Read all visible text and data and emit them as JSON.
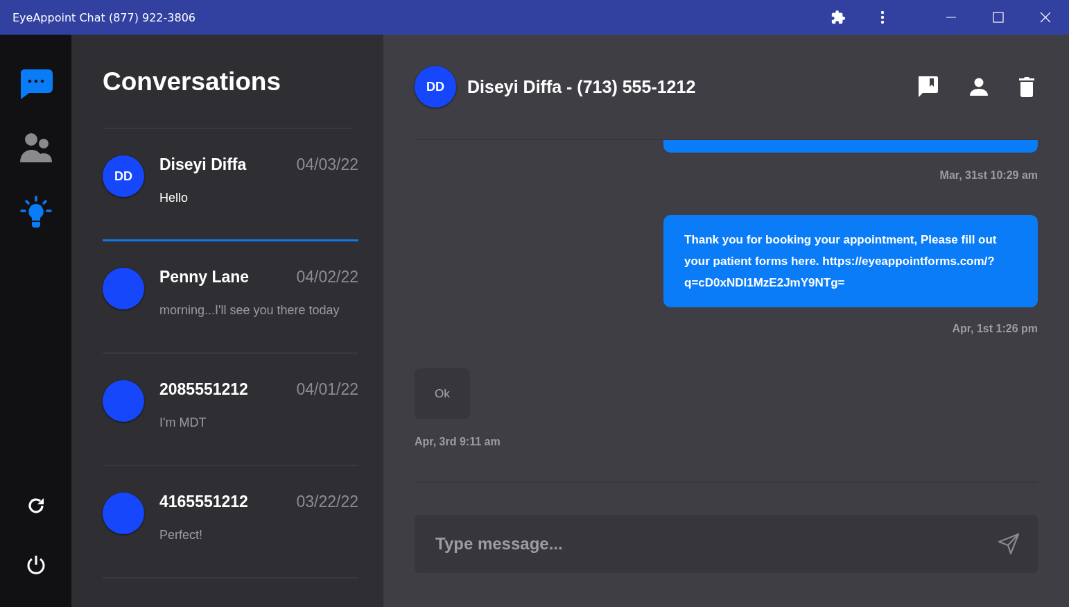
{
  "window": {
    "title": "EyeAppoint Chat (877) 922-3806"
  },
  "nav": [
    {
      "kind": "chats",
      "selected": true
    },
    {
      "kind": "contacts",
      "selected": false
    }
  ],
  "tips_button": {
    "kind": "tips"
  },
  "nav_bottom": [
    {
      "kind": "refresh"
    },
    {
      "kind": "power"
    }
  ],
  "conversations": {
    "title": "Conversations",
    "items": [
      {
        "initials": "DD",
        "name": "Diseyi Diffa",
        "date": "04/03/22",
        "preview": "Hello",
        "selected": true
      },
      {
        "name": "Penny Lane",
        "date": "04/02/22",
        "preview": "morning...I'll see you there today",
        "selected": false
      },
      {
        "name": "2085551212",
        "date": "04/01/22",
        "preview": "I'm MDT",
        "selected": false
      },
      {
        "name": "4165551212",
        "date": "03/22/22",
        "preview": "Perfect!",
        "selected": false
      }
    ]
  },
  "chat": {
    "initials": "DD",
    "title": "Diseyi Diffa - (713) 555-1212",
    "messages": [
      {
        "kind": "outgoing",
        "time": "Mar, 31st 10:29 am"
      },
      {
        "kind": "outgoing",
        "text": "Thank you for booking your appointment, Please fill out your patient forms here. https://eyeappointforms.com/?q=cD0xNDI1MzE2JmY9NTg=",
        "time": "Apr, 1st 1:26 pm"
      },
      {
        "kind": "incoming",
        "text": "Ok",
        "time": "Apr, 3rd 9:11 am"
      }
    ],
    "input": {
      "placeholder": "Type message..."
    }
  }
}
